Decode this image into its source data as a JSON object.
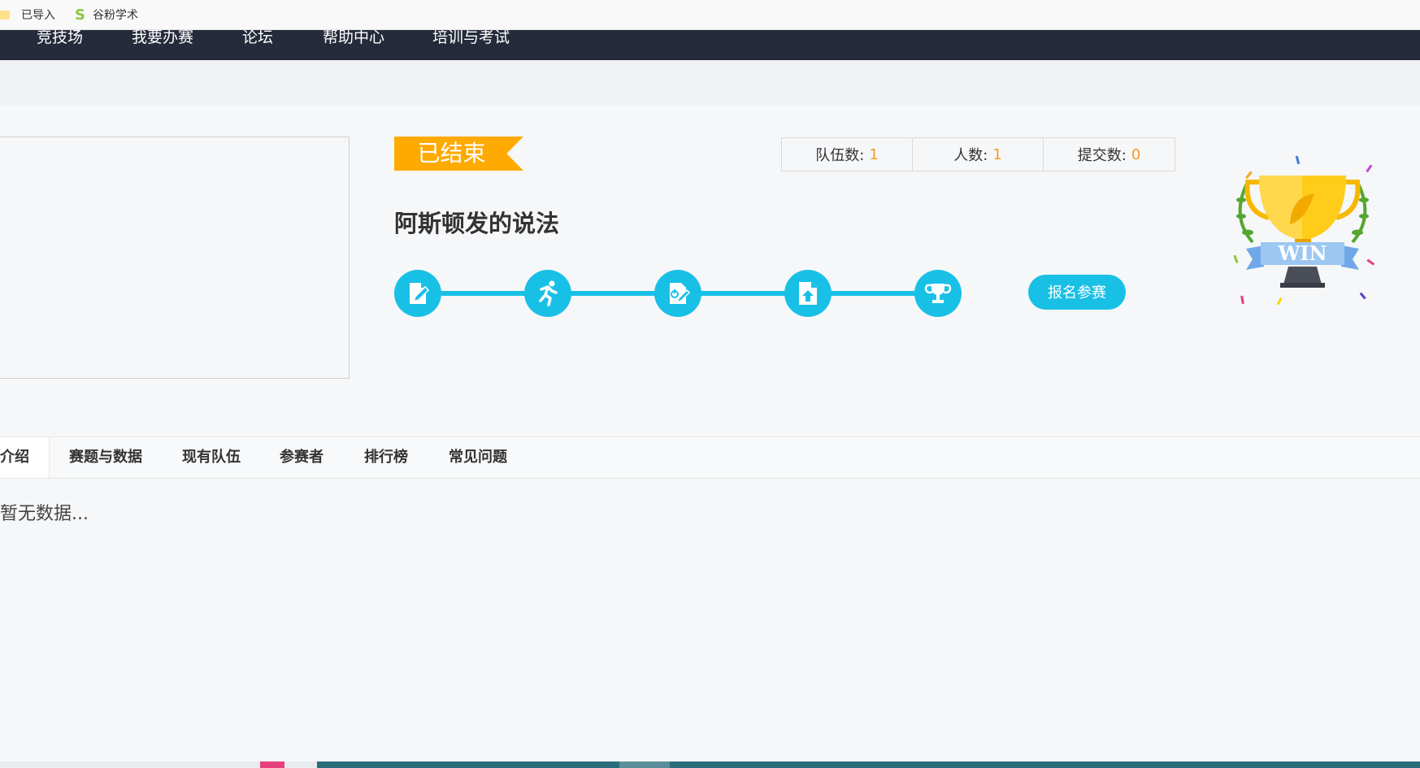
{
  "bookmarks": {
    "items": [
      {
        "label": "已导入",
        "icon": "folder-icon"
      },
      {
        "label": "谷粉学术",
        "icon": "s-logo-icon"
      }
    ]
  },
  "nav": {
    "items": [
      "竞技场",
      "我要办赛",
      "论坛",
      "帮助中心",
      "培训与考试"
    ]
  },
  "competition": {
    "status": "已结束",
    "title": "阿斯顿发的说法",
    "stats": [
      {
        "label": "队伍数:",
        "value": "1"
      },
      {
        "label": "人数:",
        "value": "1"
      },
      {
        "label": "提交数:",
        "value": "0"
      }
    ],
    "signup_label": "报名参赛",
    "trophy_text": "WIN"
  },
  "steps": [
    {
      "icon": "edit-document-icon"
    },
    {
      "icon": "running-icon"
    },
    {
      "icon": "power-document-icon"
    },
    {
      "icon": "upload-file-icon"
    },
    {
      "icon": "trophy-icon"
    }
  ],
  "tabs": {
    "items": [
      "介绍",
      "赛题与数据",
      "现有队伍",
      "参赛者",
      "排行榜",
      "常见问题"
    ],
    "active": "介绍"
  },
  "content": {
    "empty_text": "暂无数据..."
  },
  "colors": {
    "accent": "#19c0e6",
    "status": "#ffaa00",
    "stat_value": "#f39a21",
    "nav_bg": "#252b3a"
  }
}
